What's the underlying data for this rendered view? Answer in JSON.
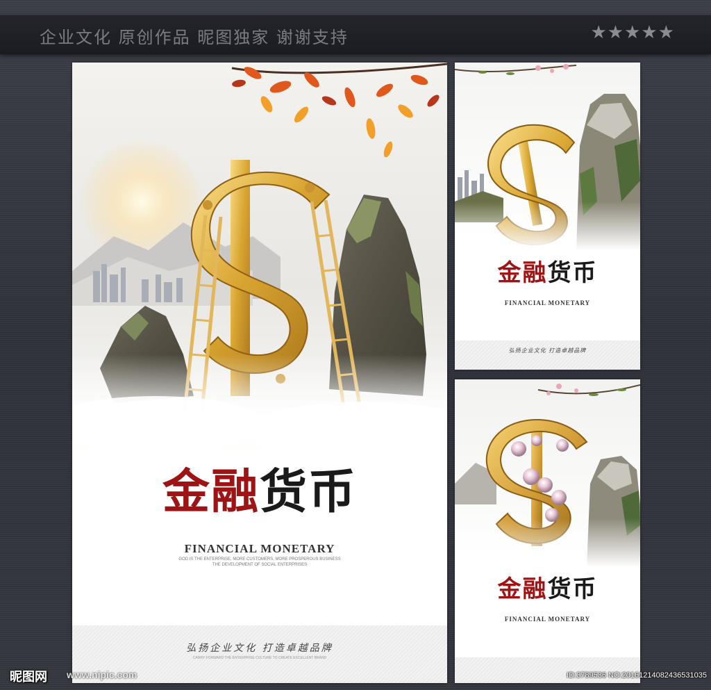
{
  "header": {
    "title": "企业文化 原创作品 昵图独家 谢谢支持",
    "stars": "★★★★★"
  },
  "posters": {
    "main": {
      "cn_title_red": "金融",
      "cn_title_black": "货币",
      "en_title": "FINANCIAL MONETARY",
      "en_sub_1": "GOD IS THE ENTERPRISE, MORE CUSTOMERS, MORE PROSPEROUS BUSINESS",
      "en_sub_2": "THE DEVELOPMENT OF SOCIAL ENTERPRISES",
      "footer_slogan": "弘扬企业文化  打造卓越品牌",
      "footer_sub": "CARRY FORWARD THE ENTERPRISE CULTURE TO CREATE EXCELLENT BRAND"
    },
    "side_a": {
      "cn_title_red": "金融",
      "cn_title_black": "货币",
      "en_title": "FINANCIAL MONETARY",
      "footer_slogan": "弘扬企业文化  打造卓越品牌"
    },
    "side_b": {
      "cn_title_red": "金融",
      "cn_title_black": "货币",
      "en_title": "FINANCIAL MONETARY"
    }
  },
  "watermark": {
    "logo": "昵图网",
    "url": "www.nipic.com",
    "id_text": "ID:3789536 NO:20161214082436531035"
  },
  "colors": {
    "background": "#33353d",
    "header_bar": "#1e1f24",
    "title_red": "#9e1414",
    "gold": "#d9a531"
  }
}
